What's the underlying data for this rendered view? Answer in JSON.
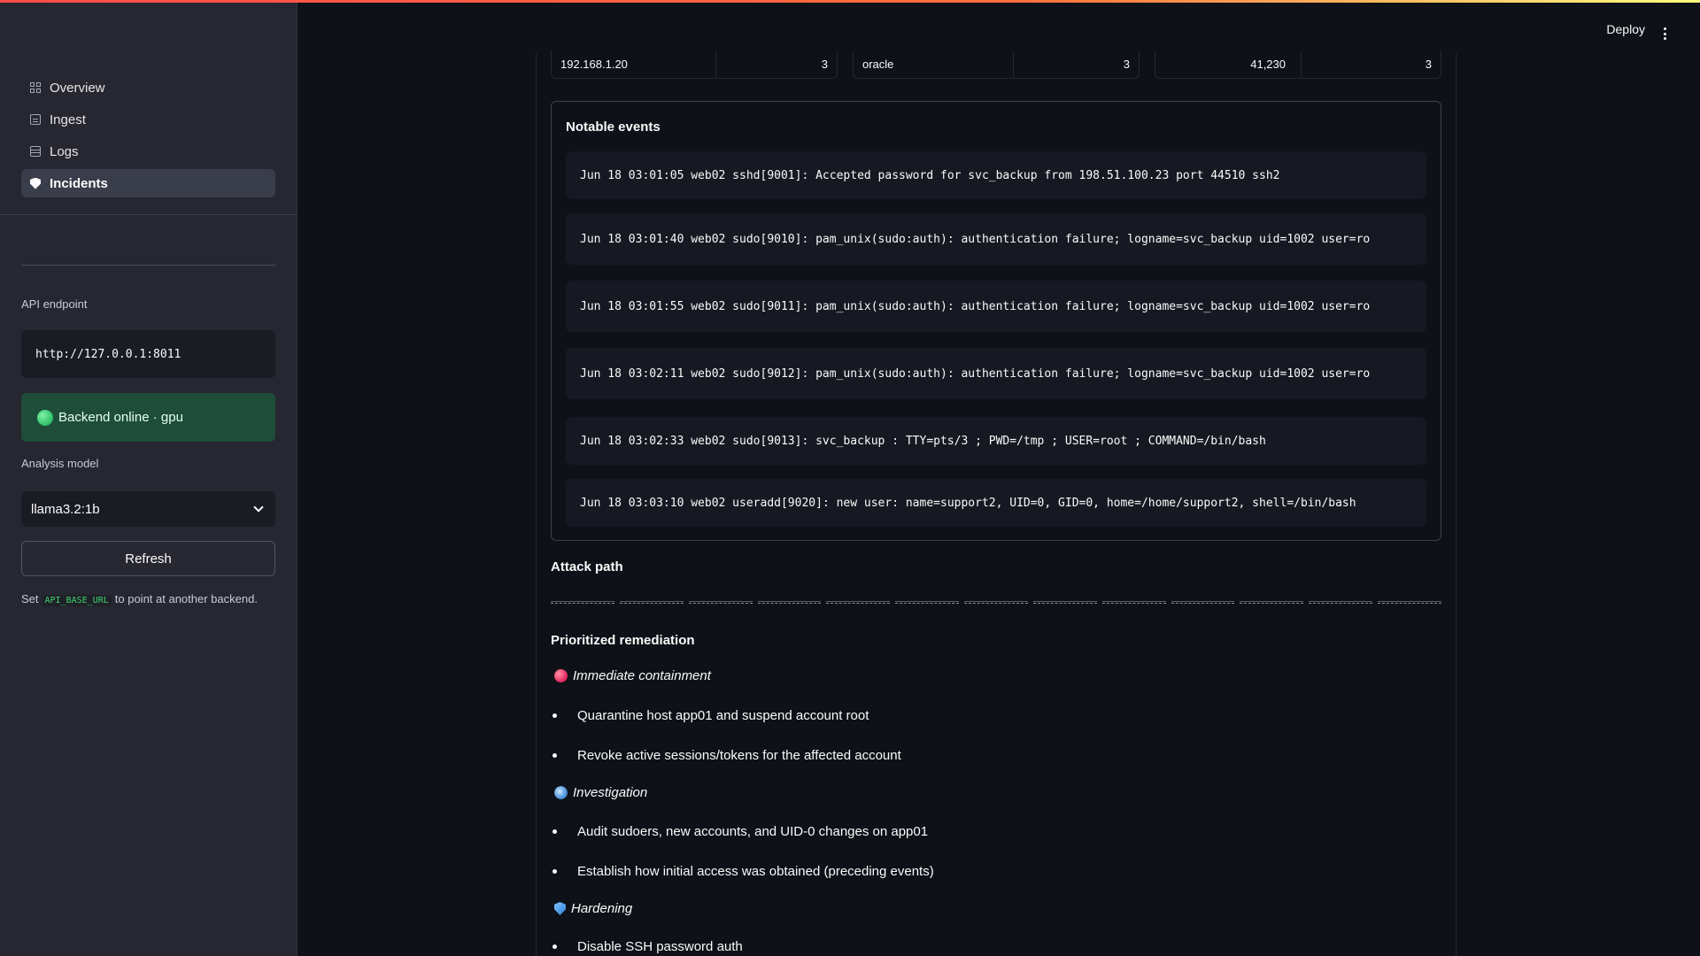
{
  "header": {
    "deploy_label": "Deploy"
  },
  "sidebar": {
    "nav": [
      {
        "label": "Overview",
        "icon": "grid-icon"
      },
      {
        "label": "Ingest",
        "icon": "document-icon"
      },
      {
        "label": "Logs",
        "icon": "table-icon"
      },
      {
        "label": "Incidents",
        "icon": "shield-icon",
        "active": true
      }
    ],
    "api_label": "API endpoint",
    "api_value": "http://127.0.0.1:8011",
    "status_text": "Backend online · gpu",
    "model_label": "Analysis model",
    "model_value": "llama3.2:1b",
    "refresh_label": "Refresh",
    "hint_prefix": "Set",
    "hint_code": "API_BASE_URL",
    "hint_suffix": "to point at another backend."
  },
  "stats": {
    "card1": {
      "label": "192.168.1.20",
      "value": "3"
    },
    "card2": {
      "label": "oracle",
      "value": "3"
    },
    "card3": {
      "label": "41,230",
      "value": "3"
    }
  },
  "notable": {
    "title": "Notable events",
    "lines": [
      "Jun 18 03:01:05 web02 sshd[9001]: Accepted password for svc_backup from 198.51.100.23 port 44510 ssh2",
      "Jun 18 03:01:40 web02 sudo[9010]: pam_unix(sudo:auth): authentication failure; logname=svc_backup uid=1002 user=ro",
      "Jun 18 03:01:55 web02 sudo[9011]: pam_unix(sudo:auth): authentication failure; logname=svc_backup uid=1002 user=ro",
      "Jun 18 03:02:11 web02 sudo[9012]: pam_unix(sudo:auth): authentication failure; logname=svc_backup uid=1002 user=ro",
      "Jun 18 03:02:33 web02 sudo[9013]: svc_backup : TTY=pts/3 ; PWD=/tmp ; USER=root ; COMMAND=/bin/bash",
      "Jun 18 03:03:10 web02 useradd[9020]: new user: name=support2, UID=0, GID=0, home=/home/support2, shell=/bin/bash"
    ]
  },
  "attack_path": {
    "title": "Attack path"
  },
  "remediation": {
    "title": "Prioritized remediation",
    "groups": [
      {
        "heading": "Immediate containment",
        "icon": "red-circle-icon",
        "items": [
          "Quarantine host app01 and suspend account root",
          "Revoke active sessions/tokens for the affected account"
        ]
      },
      {
        "heading": "Investigation",
        "icon": "magnifier-icon",
        "items": [
          "Audit sudoers, new accounts, and UID-0 changes on app01",
          "Establish how initial access was obtained (preceding events)"
        ]
      },
      {
        "heading": "Hardening",
        "icon": "shield-blue-icon",
        "items": [
          "Disable SSH password auth"
        ]
      }
    ]
  },
  "colors": {
    "background": "#0e1117",
    "sidebar": "#262730",
    "accent_red": "#ff4b4b",
    "status_green": "#1e4d3a",
    "code_green": "#3dd56d"
  }
}
